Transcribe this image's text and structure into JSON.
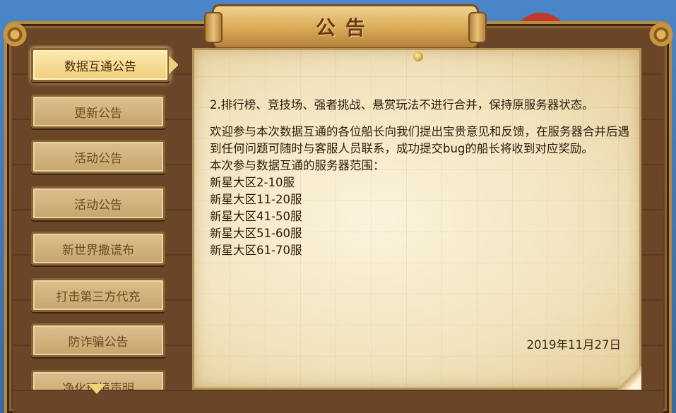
{
  "header": {
    "title": "公告"
  },
  "sidebar": {
    "tabs": [
      {
        "label": "数据互通公告",
        "active": true
      },
      {
        "label": "更新公告",
        "active": false
      },
      {
        "label": "活动公告",
        "active": false
      },
      {
        "label": "活动公告",
        "active": false
      },
      {
        "label": "新世界撒谎布",
        "active": false
      },
      {
        "label": "打击第三方代充",
        "active": false
      },
      {
        "label": "防诈骗公告",
        "active": false
      },
      {
        "label": "净化环境声明",
        "active": false
      }
    ]
  },
  "notice": {
    "line_1": "2.排行榜、竞技场、强者挑战、悬赏玩法不进行合并，保持原服务器状态。",
    "paragraph_2": "欢迎参与本次数据互通的各位船长向我们提出宝贵意见和反馈，在服务器合并后遇到任何问题可随时与客服人员联系，成功提交bug的船长将收到对应奖励。",
    "server_range_title": "本次参与数据互通的服务器范围：",
    "servers": [
      "新星大区2-10服",
      "新星大区11-20服",
      "新星大区41-50服",
      "新星大区51-60服",
      "新星大区61-70服"
    ],
    "date": "2019年11月27日"
  }
}
